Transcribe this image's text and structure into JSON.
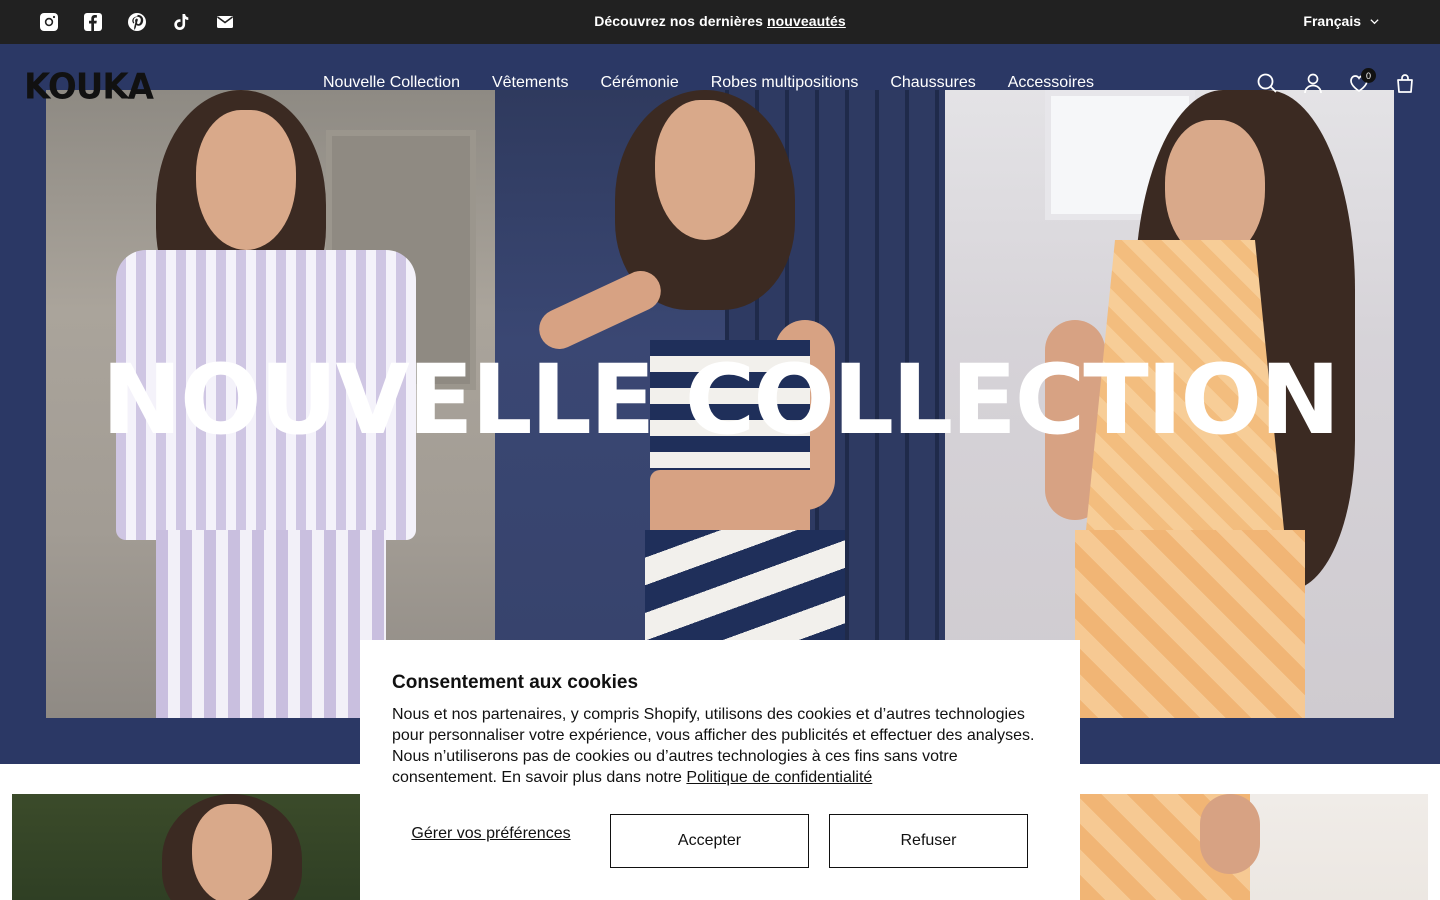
{
  "announcement": {
    "text": "Découvrez nos dernières",
    "link": "nouveautés"
  },
  "language": {
    "selected": "Français"
  },
  "brand": {
    "logo": "KOUKA"
  },
  "nav": {
    "items": [
      {
        "label": "Nouvelle Collection"
      },
      {
        "label": "Vêtements"
      },
      {
        "label": "Cérémonie"
      },
      {
        "label": "Robes multipositions"
      },
      {
        "label": "Chaussures"
      },
      {
        "label": "Accessoires"
      }
    ]
  },
  "header": {
    "wishlist_count": "0"
  },
  "socials": [
    "instagram-icon",
    "facebook-icon",
    "pinterest-icon",
    "tiktok-icon",
    "email-icon"
  ],
  "hero": {
    "headline": "NOUVELLE COLLECTION"
  },
  "cookie": {
    "title": "Consentement aux cookies",
    "body": "Nous et nos partenaires, y compris Shopify, utilisons des cookies et d’autres technologies pour personnaliser votre expérience, vous afficher des publicités et effectuer des analyses. Nous n’utiliserons pas de cookies ou d’autres technologies à ces fins sans votre consentement. En savoir plus dans notre",
    "policy_link": "Politique de confidentialité",
    "manage_label": "Gérer vos préférences",
    "accept_label": "Accepter",
    "refuse_label": "Refuser"
  },
  "colors": {
    "topbar": "#212121",
    "hero_background": "#2b3865",
    "text": "#111111"
  }
}
